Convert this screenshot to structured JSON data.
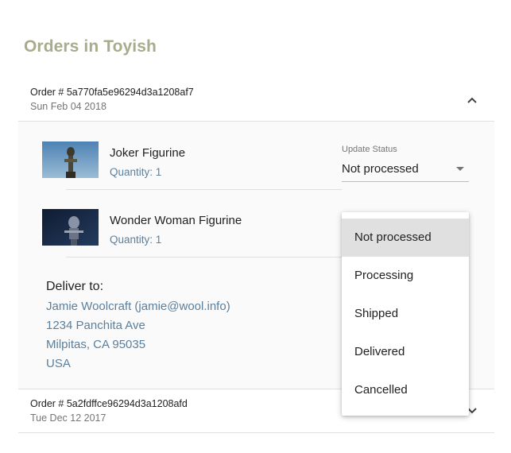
{
  "page": {
    "title": "Orders in Toyish"
  },
  "orders": [
    {
      "number": "Order # 5a770fa5e96294d3a1208af7",
      "date": "Sun Feb 04 2018",
      "items": [
        {
          "name": "Joker Figurine",
          "quantity": "Quantity: 1",
          "image_icon": "joker-figurine-thumbnail"
        },
        {
          "name": "Wonder Woman Figurine",
          "quantity": "Quantity: 1",
          "image_icon": "wonder-woman-figurine-thumbnail"
        }
      ],
      "status": {
        "label": "Update Status",
        "value": "Not processed"
      },
      "delivery": {
        "title": "Deliver to:",
        "name": "Jamie Woolcraft (jamie@wool.info)",
        "street": "1234 Panchita Ave",
        "city": "Milpitas, CA 95035",
        "country": "USA"
      }
    },
    {
      "number": "Order # 5a2fdffce96294d3a1208afd",
      "date": "Tue Dec 12 2017"
    }
  ],
  "status_options": [
    "Not processed",
    "Processing",
    "Shipped",
    "Delivered",
    "Cancelled"
  ],
  "colors": {
    "title": "#a8ab8c",
    "accent_text": "#5b7f9c",
    "selected_bg": "#e0e0e0"
  },
  "icons": {
    "collapse": "chevron-up-icon",
    "expand": "chevron-down-icon",
    "select_arrow": "dropdown-arrow-icon"
  }
}
